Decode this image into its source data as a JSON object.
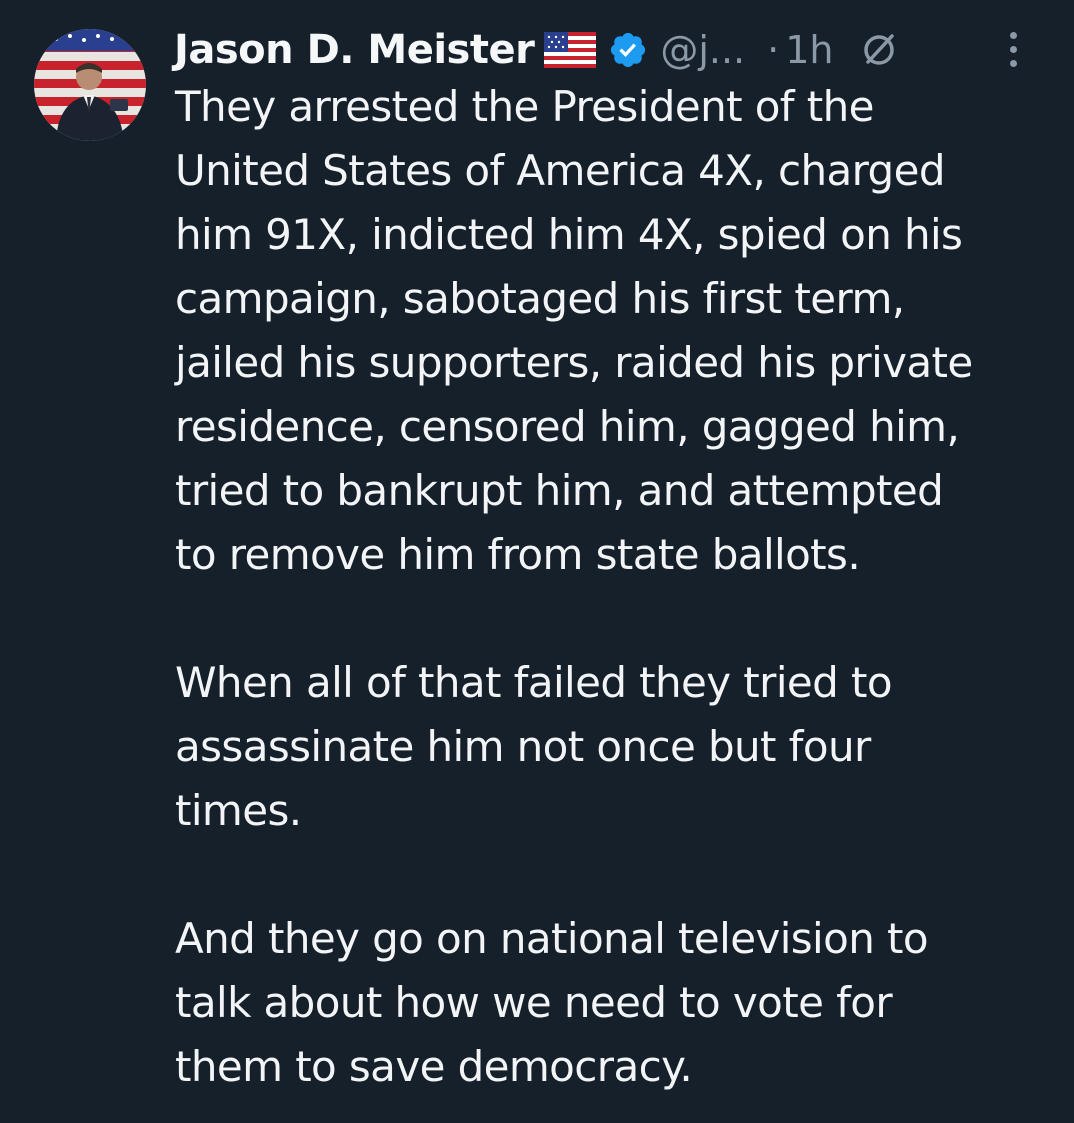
{
  "author": {
    "name": "Jason D. Meister",
    "handle": "@j...",
    "separator": "·",
    "timestamp": "1h",
    "flag_icon": "us-flag-emoji",
    "verified_icon": "verified-badge-icon",
    "verified_color": "#1d9bf0",
    "grok_icon": "grok-icon"
  },
  "tweet": {
    "paragraphs": [
      {
        "lines": [
          "They arrested the President of the",
          "United States of America 4X, charged",
          "him 91X, indicted him 4X, spied on his",
          "campaign, sabotaged his first term,",
          "jailed his supporters, raided his private",
          "residence, censored him, gagged him,",
          "tried to bankrupt him, and attempted",
          "to remove him from state ballots."
        ]
      },
      {
        "lines": [
          "When all of that failed they tried to",
          "assassinate him not once but four",
          "times."
        ]
      },
      {
        "lines": [
          "And they go on national television to",
          "talk about how we need to vote for",
          "them to save democracy."
        ]
      }
    ]
  },
  "colors": {
    "background": "#15202b",
    "text": "#f2f4f6",
    "secondary": "#8b98a5"
  }
}
